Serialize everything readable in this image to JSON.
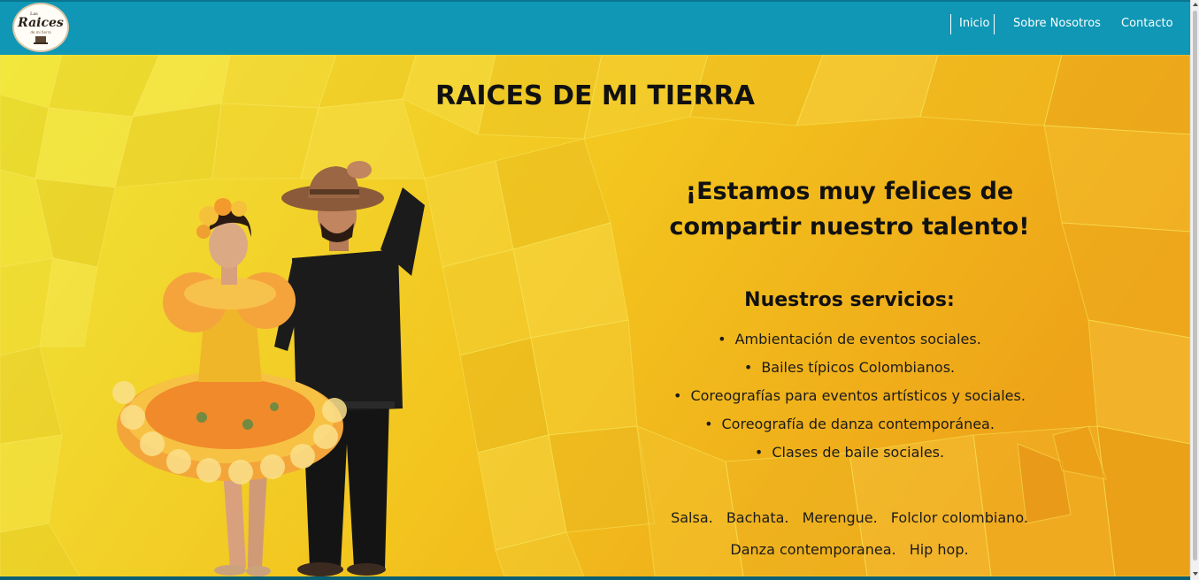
{
  "navbar": {
    "logo": {
      "line1": "Las",
      "line2": "Raices",
      "line3": "de mi tierra",
      "icon": "logo-emblem"
    },
    "links": [
      "Inicio",
      "Sobre Nosotros",
      "Contacto"
    ]
  },
  "hero": {
    "title": "RAICES DE MI TIERRA",
    "headline_line1": "¡Estamos muy felices de",
    "headline_line2": "compartir nuestro talento!",
    "services_title": "Nuestros servicios:",
    "services": [
      "Ambientación de eventos sociales.",
      "Bailes típicos Colombianos.",
      "Coreografías para eventos artísticos y sociales.",
      "Coreografía de danza contemporánea.",
      "Clases de baile sociales."
    ],
    "genres_line1": [
      "Salsa.",
      "Bachata.",
      "Merengue.",
      "Folclor colombiano."
    ],
    "genres_line2": [
      "Danza contemporanea.",
      "Hip hop."
    ],
    "image": "dancers-photo"
  },
  "colors": {
    "navbar": "#0f97b5",
    "background": "#f2c41a",
    "text": "#111111"
  }
}
